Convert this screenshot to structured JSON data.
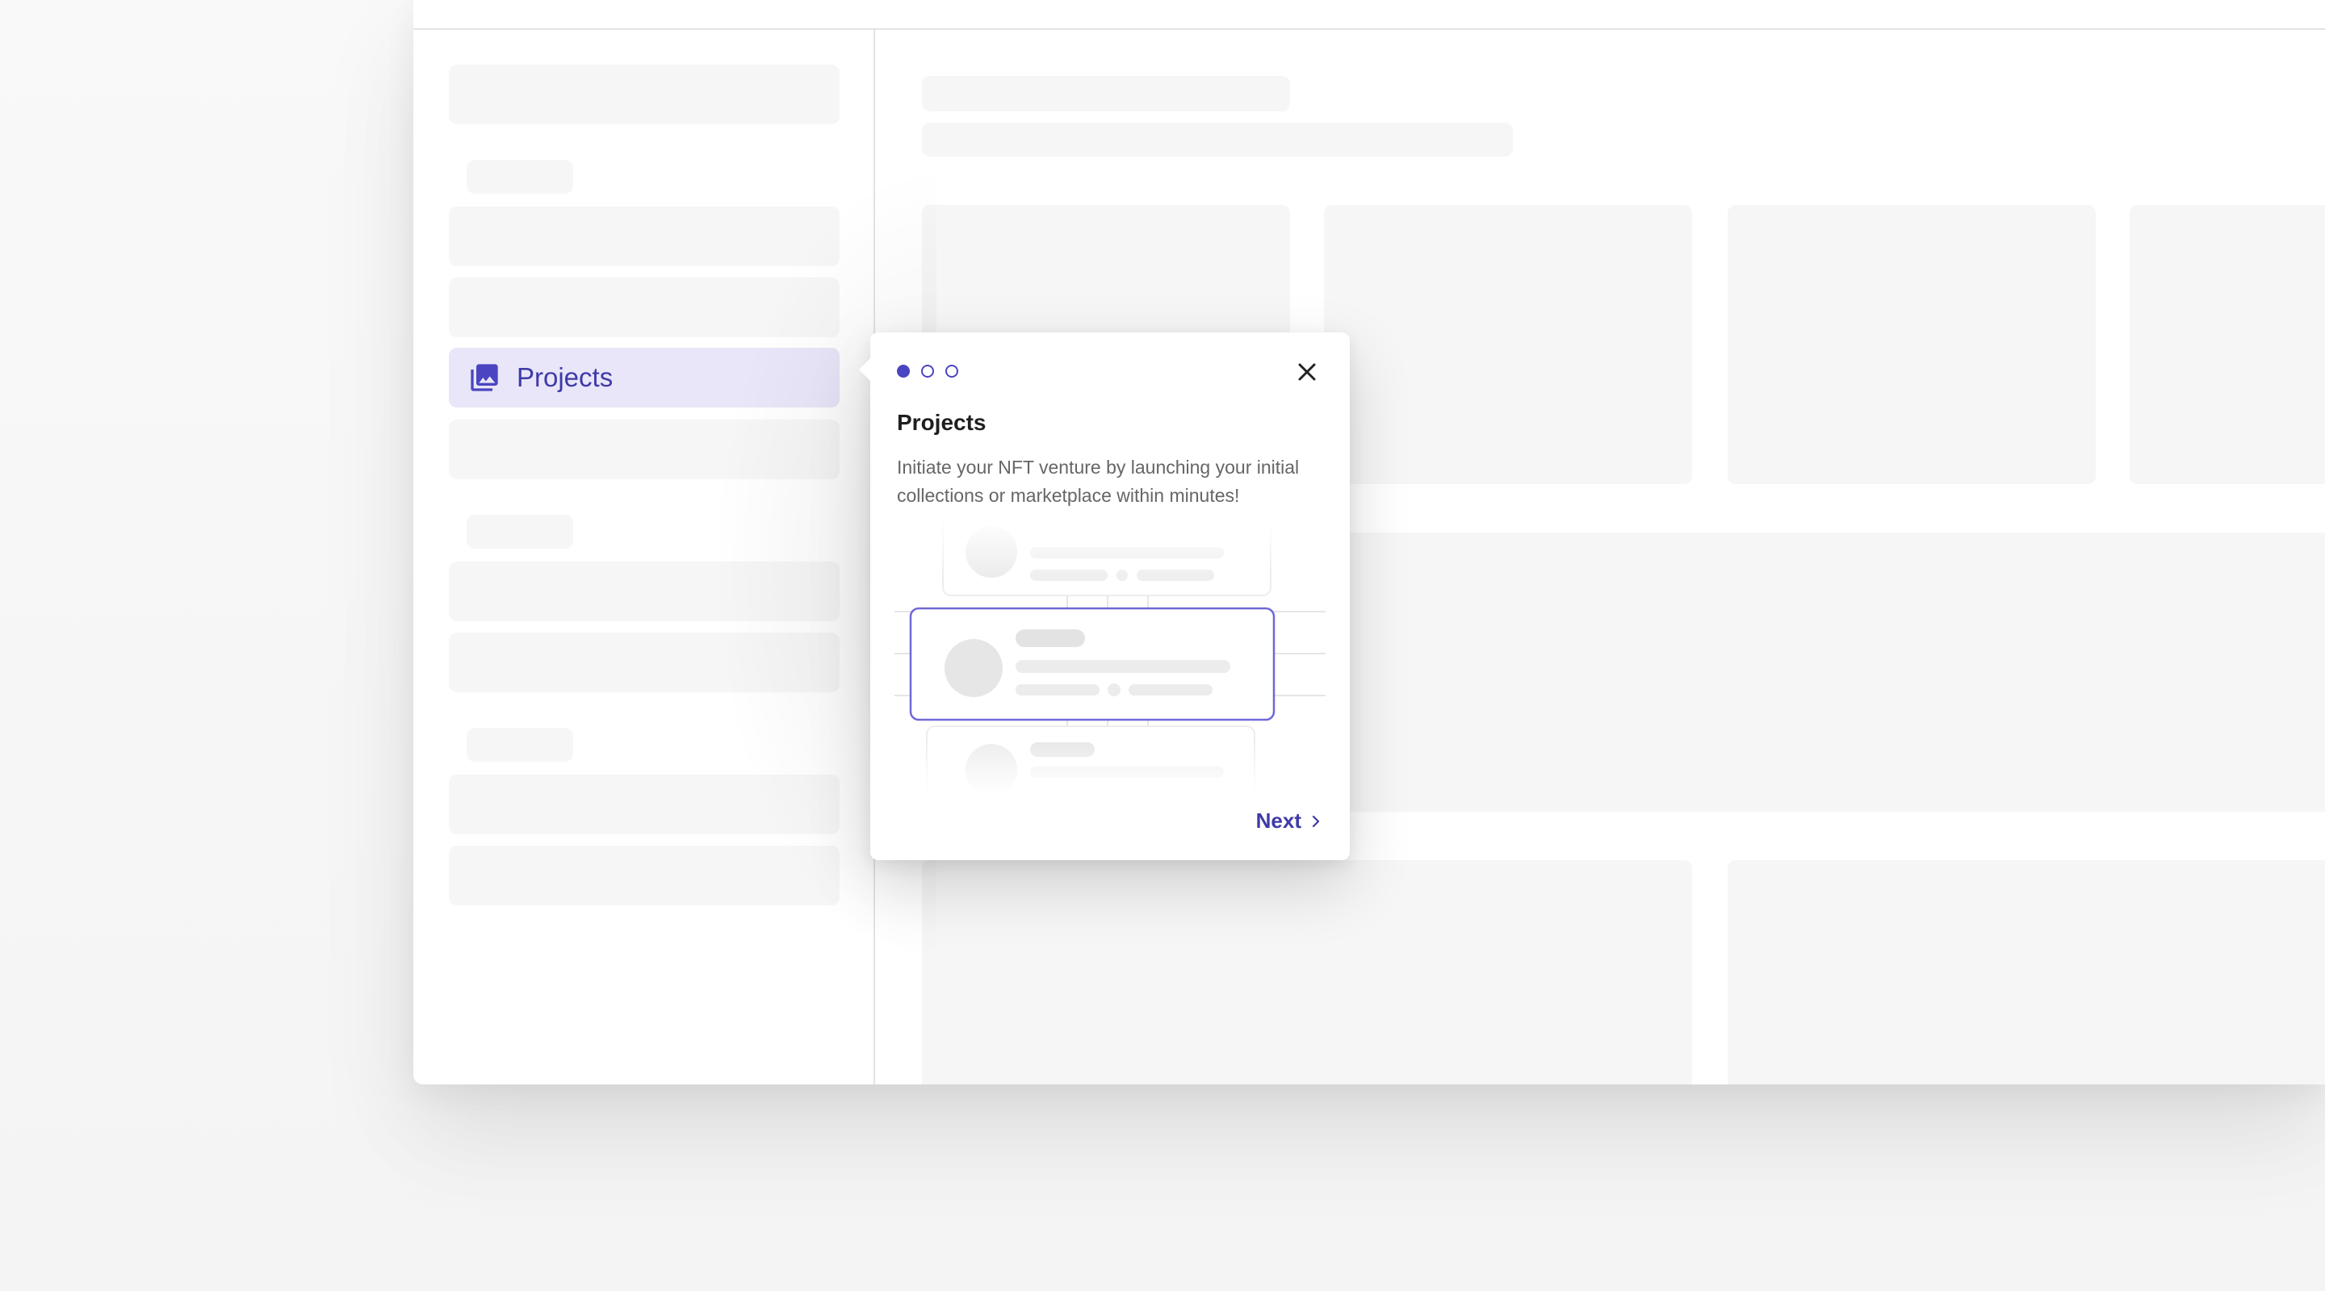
{
  "sidebar": {
    "active_item": {
      "label": "Projects",
      "icon": "photo-library-icon"
    }
  },
  "onboarding": {
    "step_indicator": {
      "current": 1,
      "total": 3
    },
    "title": "Projects",
    "description": "Initiate your NFT venture by launching your initial collections or marketplace within minutes!",
    "next_label": "Next",
    "close_icon": "close-icon",
    "next_icon": "chevron-right-icon"
  },
  "colors": {
    "accent": "#4b45c1",
    "active_nav_bg": "#e8e6f8",
    "skeleton": "#f6f6f6"
  }
}
